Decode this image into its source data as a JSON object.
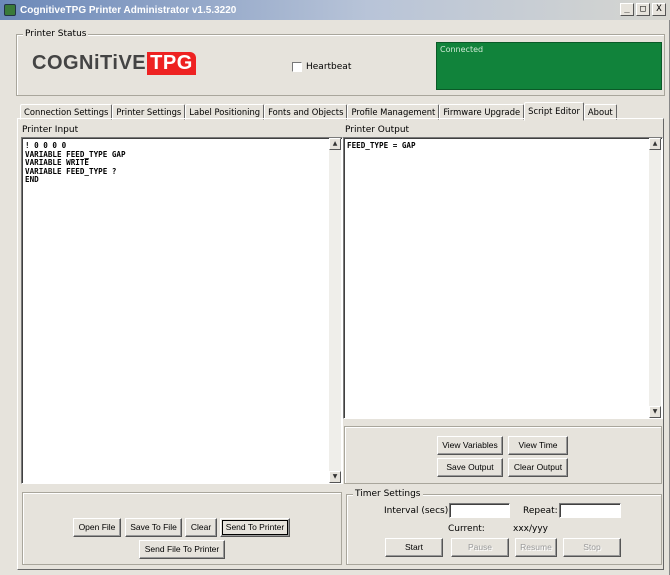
{
  "window": {
    "title": "CognitiveTPG Printer Administrator v1.5.3220",
    "controls": [
      "_",
      "□",
      "X"
    ]
  },
  "printer_status": {
    "legend": "Printer Status",
    "logo_text_a": "COGNiTiVE",
    "logo_text_b": "TPG",
    "heartbeat_label": "Heartbeat",
    "heartbeat_checked": false,
    "status_text": "Connected",
    "status_color": "#11833b"
  },
  "tabs": [
    {
      "label": "Connection Settings",
      "active": false
    },
    {
      "label": "Printer Settings",
      "active": false
    },
    {
      "label": "Label Positioning",
      "active": false
    },
    {
      "label": "Fonts and Objects",
      "active": false
    },
    {
      "label": "Profile Management",
      "active": false
    },
    {
      "label": "Firmware Upgrade",
      "active": false
    },
    {
      "label": "Script Editor",
      "active": true
    },
    {
      "label": "About",
      "active": false
    }
  ],
  "printer_input": {
    "label": "Printer Input",
    "text": "! 0 0 0 0\nVARIABLE FEED_TYPE GAP\nVARIABLE WRITE\nVARIABLE FEED_TYPE ?\nEND"
  },
  "printer_output": {
    "label": "Printer Output",
    "text": "FEED_TYPE = GAP"
  },
  "output_buttons": {
    "view_variables": "View Variables",
    "view_time": "View Time",
    "save_output": "Save Output",
    "clear_output": "Clear Output"
  },
  "input_buttons": {
    "open_file": "Open File",
    "save_to_file": "Save To File",
    "clear": "Clear",
    "send_to_printer": "Send To Printer",
    "send_file_to_printer": "Send File To Printer"
  },
  "timer": {
    "legend": "Timer Settings",
    "interval_label": "Interval (secs):",
    "interval_value": "",
    "repeat_label": "Repeat:",
    "repeat_value": "",
    "current_label": "Current:",
    "current_value": "xxx/yyy",
    "start": "Start",
    "pause": "Pause",
    "resume": "Resume",
    "stop": "Stop"
  }
}
